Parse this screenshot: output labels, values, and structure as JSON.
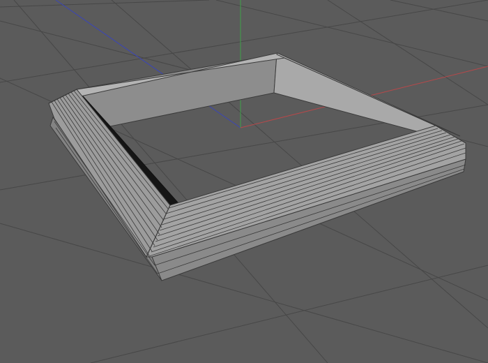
{
  "viewport": {
    "view": "perspective",
    "shading": "gouraud-shading-lines",
    "show_grid": true,
    "show_world_axes": true
  },
  "scene": {
    "object": "square-frame",
    "object_color": "#a4a4a4"
  },
  "colors": {
    "background": "#5b5b5b",
    "grid_line": "#474747",
    "grid_major": "#404040",
    "axis_x": "#b8484a",
    "axis_y": "#3fa14a",
    "axis_z": "#3a45b8",
    "edge_wire": "#3a3a3a",
    "shadow_edge": "#111111"
  }
}
